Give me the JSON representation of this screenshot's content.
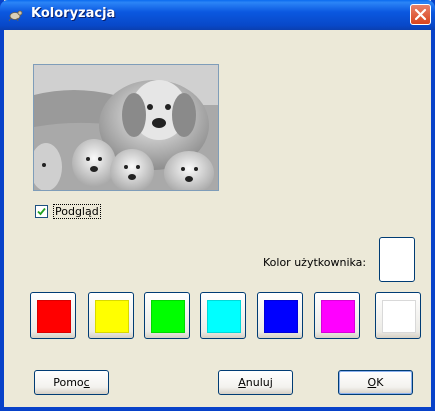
{
  "window": {
    "title": "Koloryzacja"
  },
  "preview": {
    "alt": "Podgląd koloryzacji: psy rasy golden retriever"
  },
  "preview_checkbox": {
    "label": "Podgląd",
    "checked": true
  },
  "user_color": {
    "label": "Kolor użytkownika:",
    "color": "#ffffff"
  },
  "palette": [
    {
      "name": "red",
      "color": "#ff0000"
    },
    {
      "name": "yellow",
      "color": "#ffff00"
    },
    {
      "name": "green",
      "color": "#00ff00"
    },
    {
      "name": "cyan",
      "color": "#00ffff"
    },
    {
      "name": "blue",
      "color": "#0000ff"
    },
    {
      "name": "magenta",
      "color": "#ff00ff"
    },
    {
      "name": "white",
      "color": "#ffffff"
    }
  ],
  "buttons": {
    "help": {
      "prefix": "Pomo",
      "mnemonic": "c",
      "suffix": ""
    },
    "cancel": {
      "prefix": "",
      "mnemonic": "A",
      "suffix": "nuluj"
    },
    "ok": {
      "prefix": "",
      "mnemonic": "O",
      "suffix": "K"
    }
  },
  "theme": {
    "titlebar": "#0848c8",
    "dialog_bg": "#ece9d8"
  }
}
